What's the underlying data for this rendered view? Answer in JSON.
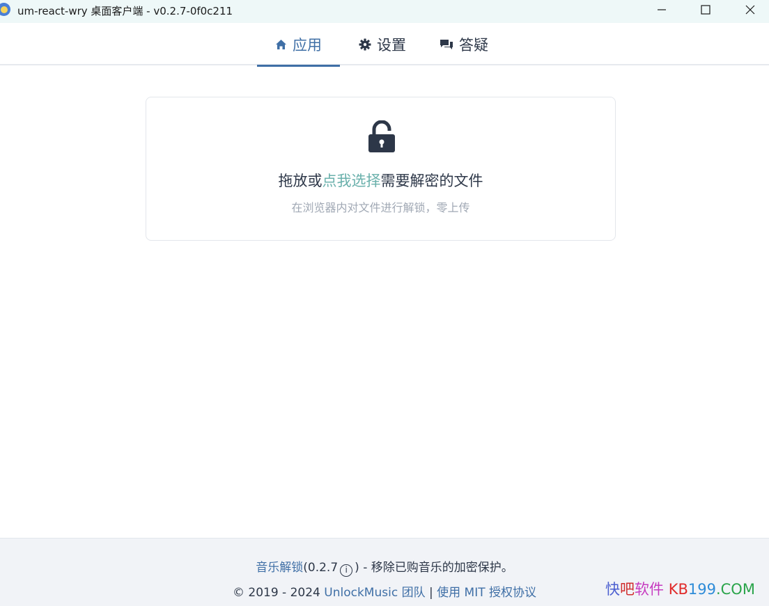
{
  "window": {
    "title": "um-react-wry 桌面客户端 - v0.2.7-0f0c211"
  },
  "tabs": [
    {
      "label": "应用",
      "icon": "home-icon",
      "active": true
    },
    {
      "label": "设置",
      "icon": "gear-icon",
      "active": false
    },
    {
      "label": "答疑",
      "icon": "chat-icon",
      "active": false
    }
  ],
  "dropzone": {
    "icon": "unlock-icon",
    "prefix": "拖放或",
    "link": "点我选择",
    "suffix": "需要解密的文件",
    "subtitle": "在浏览器内对文件进行解锁，零上传"
  },
  "footer": {
    "app_link": "音乐解锁",
    "version": "(0.2.7",
    "info_symbol": "i",
    "desc": ") - 移除已购音乐的加密保护。",
    "copyright": "© 2019 - 2024",
    "team_link": "UnlockMusic 团队",
    "separator": "|",
    "license_link": "使用 MIT 授权协议"
  },
  "watermark": {
    "part1": "快",
    "part2": "吧",
    "part3": "软件",
    "part4": "KB",
    "part5": "199",
    "part6": ".COM"
  },
  "colors": {
    "accent": "#3f6fa6",
    "link_teal": "#69b0ab",
    "titlebar_bg": "#eef8f8",
    "footer_bg": "#f1f3f7"
  }
}
